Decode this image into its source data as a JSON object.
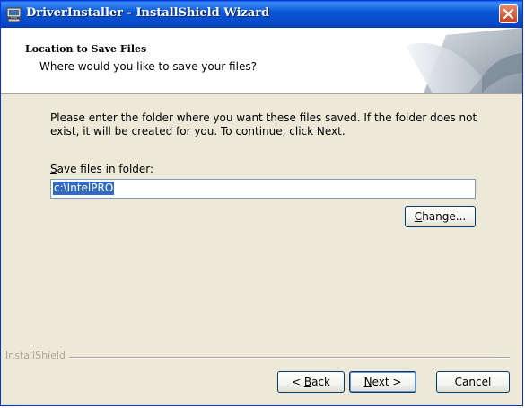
{
  "window": {
    "title": "DriverInstaller - InstallShield Wizard"
  },
  "header": {
    "title": "Location to Save Files",
    "subtitle": "Where would you like to save your files?"
  },
  "body": {
    "instructions": "Please enter the folder where you want these files saved.  If the folder does not exist, it will be created for you.   To continue, click Next.",
    "folder_label_accel": "S",
    "folder_label_rest": "ave files in folder:",
    "folder_value": "c:\\IntelPRO"
  },
  "buttons": {
    "change_accel": "C",
    "change_rest": "hange...",
    "back_prefix": "< ",
    "back_accel": "B",
    "back_rest": "ack",
    "next_accel": "N",
    "next_rest": "ext >",
    "cancel": "Cancel"
  },
  "footer": {
    "brand": "InstallShield"
  },
  "icons": {
    "app": "installer-computer-icon",
    "close": "close-icon",
    "header_graphic": "page-curl-graphic"
  }
}
